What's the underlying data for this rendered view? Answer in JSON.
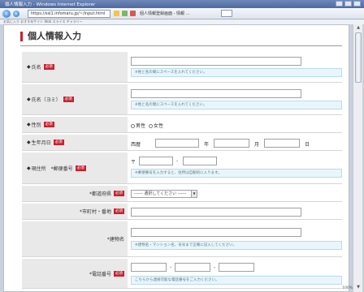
{
  "browser": {
    "window_title": "個人情報入力 - Windows Internet Explorer",
    "url": "https://ssl1.infomaru.jp/~/input.html",
    "tab_label": "個人情報登録画面 - 情報 …",
    "favorites": "お気に入り  おすすめサイト  Web スライス ギャラリー",
    "zoom": "100%"
  },
  "page": {
    "title": "個人情報入力"
  },
  "labels": {
    "required": "必須",
    "bullet": "◆"
  },
  "form": {
    "name": {
      "label": "氏名",
      "hint": "※姓と名の間にスペースを入れてください。"
    },
    "name_kana": {
      "label": "氏名（ヨミ）",
      "hint": "※姓と名の間にスペースを入れてください。"
    },
    "gender": {
      "label": "性別",
      "options": [
        "男性",
        "女性"
      ]
    },
    "birthdate": {
      "label": "生年月日",
      "era": "西暦",
      "year": "年",
      "month": "月",
      "day": "日"
    },
    "address": {
      "group_label": "現住所",
      "postal_label": "*郵便番号",
      "postal_prefix": "〒",
      "postal_dash": "-",
      "postal_hint": "※郵便番号を入力すると、住所は自動的に入ります。",
      "prefecture_label": "*都道府県",
      "prefecture_select": "------ 選択してください ------",
      "city_label": "*市町村・番地",
      "building_label": "*建物名",
      "building_hint": "※建物名・マンション名、号号まで正確に記入してください。"
    },
    "phone": {
      "label": "*電話番号",
      "dash": "-",
      "hint": "こちらから連絡可能な電話番号をご入力ください。"
    }
  }
}
